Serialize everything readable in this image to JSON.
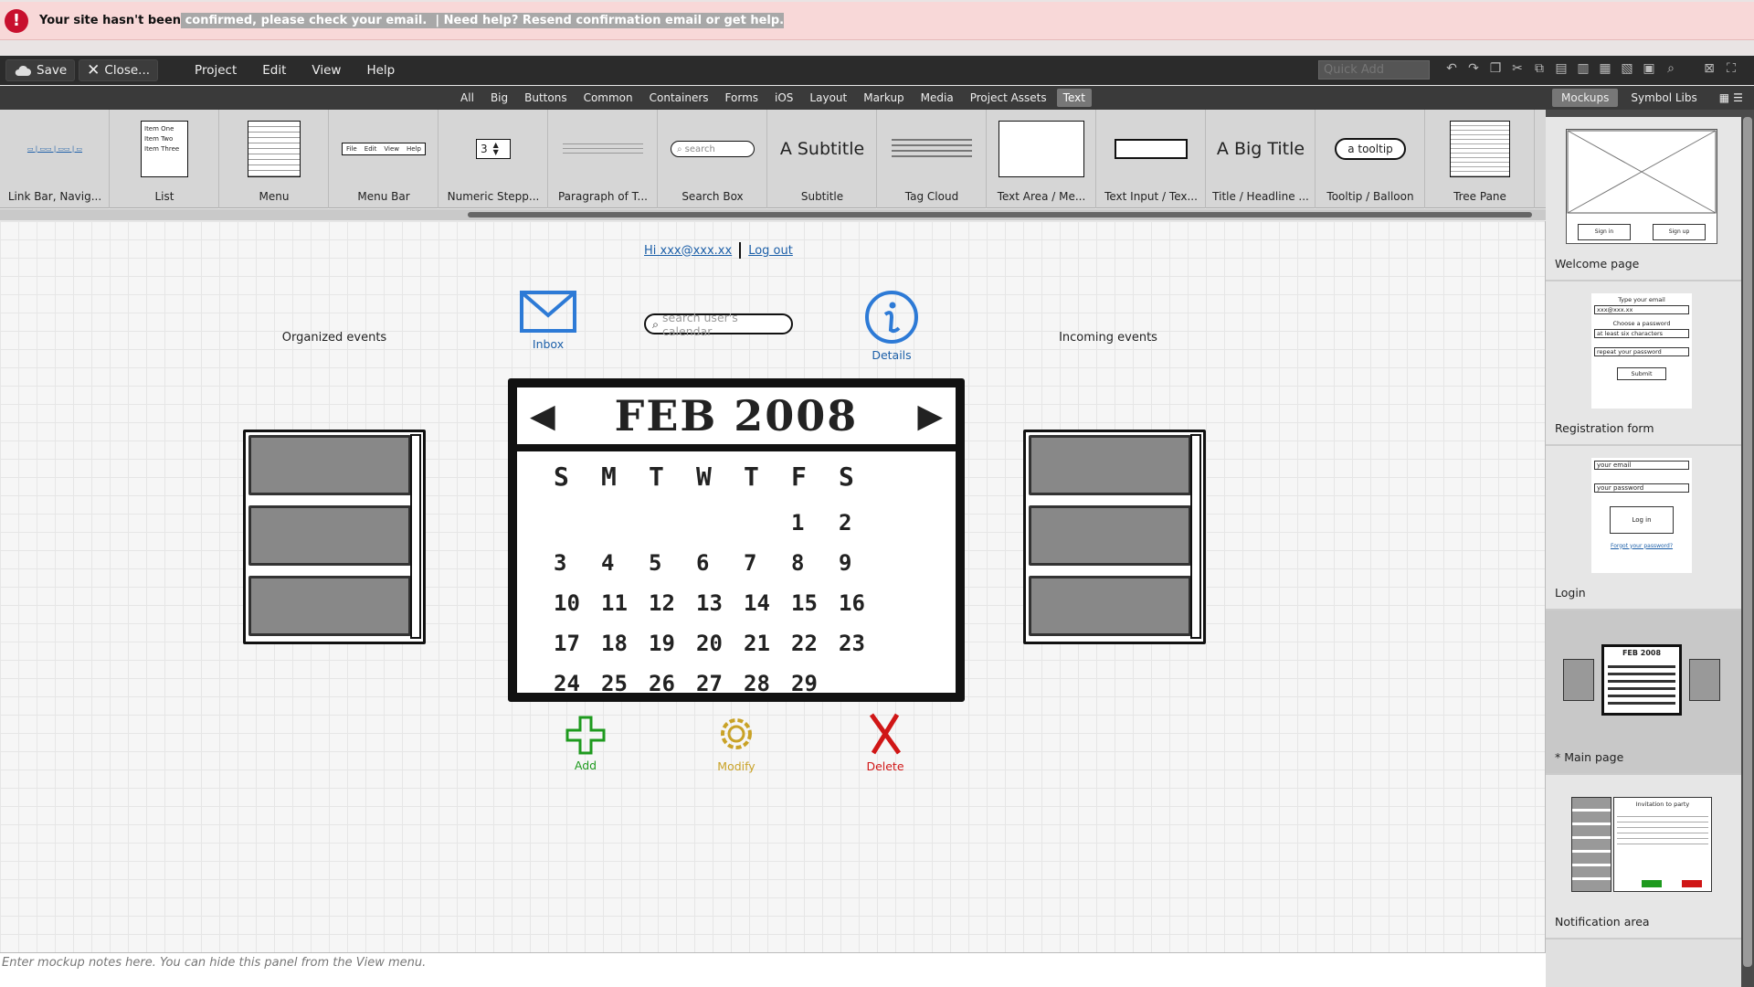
{
  "notice": {
    "part1": "Your site hasn't been",
    "part2": "confirmed, please check your email.",
    "part3": "| Need help?",
    "part4": "Resend confirmation email or get help."
  },
  "toolbar": {
    "save": "Save",
    "close": "Close...",
    "menus": [
      "Project",
      "Edit",
      "View",
      "Help"
    ],
    "quick_add_placeholder": "Quick Add"
  },
  "categories": [
    "All",
    "Big",
    "Buttons",
    "Common",
    "Containers",
    "Forms",
    "iOS",
    "Layout",
    "Markup",
    "Media",
    "Project Assets",
    "Text"
  ],
  "active_category": "Text",
  "library": [
    {
      "label": "Link Bar, Navig..."
    },
    {
      "label": "List",
      "items": [
        "Item One",
        "Item Two",
        "Item Three"
      ]
    },
    {
      "label": "Menu"
    },
    {
      "label": "Menu Bar",
      "items": [
        "File",
        "Edit",
        "View",
        "Help"
      ]
    },
    {
      "label": "Numeric Stepp...",
      "value": "3"
    },
    {
      "label": "Paragraph of T..."
    },
    {
      "label": "Search Box",
      "placeholder": "search"
    },
    {
      "label": "Subtitle",
      "preview": "A Subtitle"
    },
    {
      "label": "Tag Cloud"
    },
    {
      "label": "Text Area / Me..."
    },
    {
      "label": "Text Input / Tex..."
    },
    {
      "label": "Title / Headline ...",
      "preview": "A Big Title"
    },
    {
      "label": "Tooltip / Balloon",
      "preview": "a tooltip"
    },
    {
      "label": "Tree Pane"
    }
  ],
  "right_panel": {
    "tabs": [
      "Mockups",
      "Symbol Libs"
    ],
    "active_tab": "Mockups",
    "mockups": [
      {
        "label": "Welcome page",
        "buttons": [
          "Sign in",
          "Sign up"
        ]
      },
      {
        "label": "Registration form",
        "fields": [
          "Type your email",
          "xxx@xxx.xx",
          "Choose a password",
          "at least six characters",
          "repeat your password"
        ],
        "button": "Submit"
      },
      {
        "label": "Login",
        "fields": [
          "your email",
          "your password"
        ],
        "button": "Log in",
        "link": "Forgot your password?"
      },
      {
        "label": "* Main page"
      },
      {
        "label": "Notification area",
        "title": "Invitation to party"
      }
    ]
  },
  "canvas": {
    "greeting": "Hi xxx@xxx.xx",
    "logout": "Log out",
    "inbox": "Inbox",
    "search_placeholder": "search user's calendar",
    "details": "Details",
    "organized_title": "Organized events",
    "incoming_title": "Incoming events",
    "calendar": {
      "month": "FEB 2008",
      "weekdays": [
        "S",
        "M",
        "T",
        "W",
        "T",
        "F",
        "S"
      ],
      "weeks": [
        [
          "",
          "",
          "",
          "",
          "",
          "1",
          "2"
        ],
        [
          "3",
          "4",
          "5",
          "6",
          "7",
          "8",
          "9"
        ],
        [
          "10",
          "11",
          "12",
          "13",
          "14",
          "15",
          "16"
        ],
        [
          "17",
          "18",
          "19",
          "20",
          "21",
          "22",
          "23"
        ],
        [
          "24",
          "25",
          "26",
          "27",
          "28",
          "29",
          ""
        ]
      ]
    },
    "add": "Add",
    "modify": "Modify",
    "delete": "Delete"
  },
  "notes_placeholder": "Enter mockup notes here. You can hide this panel from the View menu.",
  "colors": {
    "add": "#1e9a1e",
    "modify": "#c9a227",
    "delete": "#d01616",
    "link": "#1c5fa8"
  }
}
